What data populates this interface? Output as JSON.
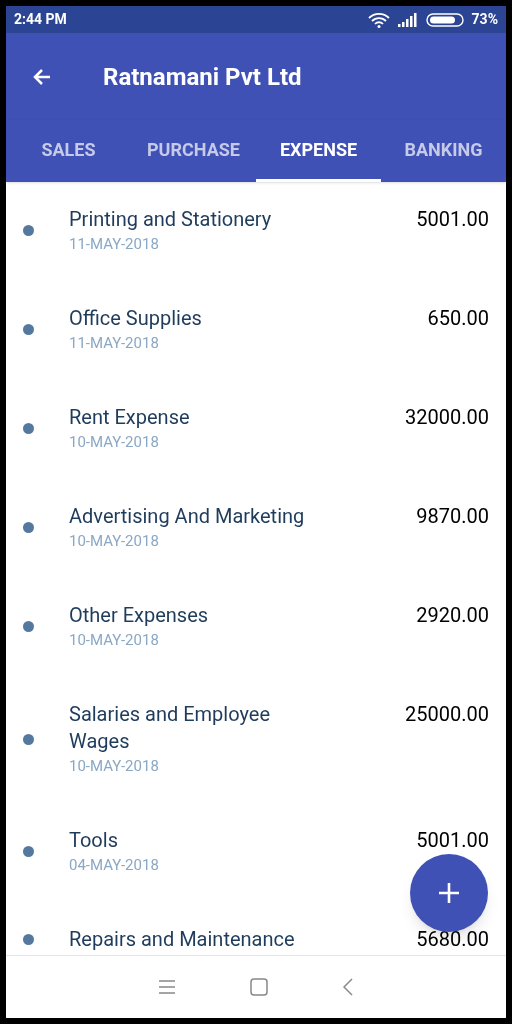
{
  "status_bar": {
    "time": "2:44 PM",
    "battery": "73%"
  },
  "app_bar": {
    "title": "Ratnamani Pvt Ltd"
  },
  "tabs": [
    {
      "label": "SALES",
      "selected": false
    },
    {
      "label": "PURCHASE",
      "selected": false
    },
    {
      "label": "EXPENSE",
      "selected": true
    },
    {
      "label": "BANKING",
      "selected": false
    }
  ],
  "expenses": [
    {
      "name": "Printing and Stationery",
      "date": "11-MAY-2018",
      "amount": "5001.00"
    },
    {
      "name": "Office Supplies",
      "date": "11-MAY-2018",
      "amount": "650.00"
    },
    {
      "name": "Rent Expense",
      "date": "10-MAY-2018",
      "amount": "32000.00"
    },
    {
      "name": "Advertising And Marketing",
      "date": "10-MAY-2018",
      "amount": "9870.00"
    },
    {
      "name": "Other Expenses",
      "date": "10-MAY-2018",
      "amount": "2920.00"
    },
    {
      "name": "Salaries and Employee Wages",
      "date": "10-MAY-2018",
      "amount": "25000.00"
    },
    {
      "name": "Tools",
      "date": "04-MAY-2018",
      "amount": "5001.00"
    },
    {
      "name": "Repairs and Maintenance",
      "amount": "5680.00"
    }
  ]
}
